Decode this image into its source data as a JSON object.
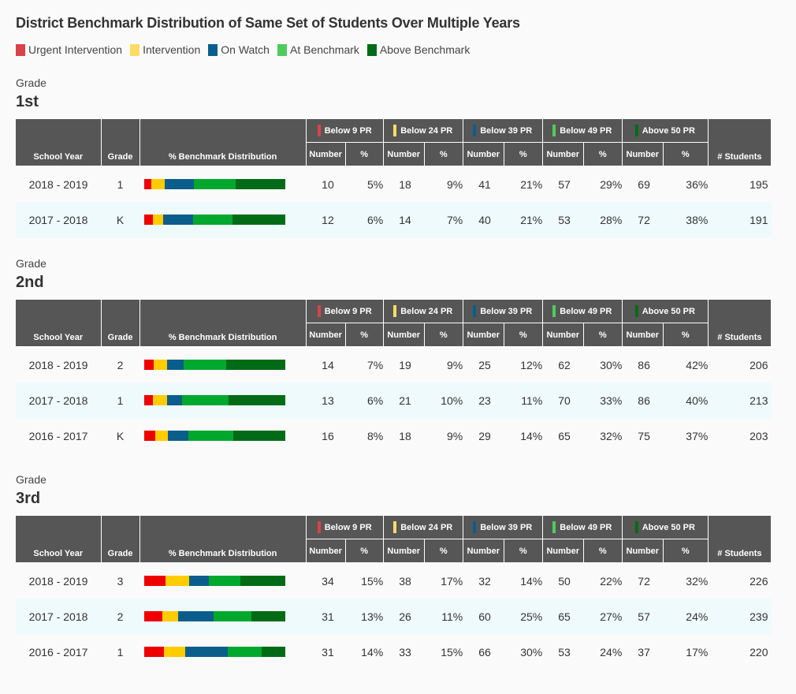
{
  "title": "District Benchmark Distribution of Same Set of Students Over Multiple Years",
  "colors": {
    "urgent": "#ee0000",
    "intervention": "#ffcc00",
    "watch": "#0b5e8c",
    "at": "#00a82d",
    "above": "#006b16",
    "legend_urgent": "#d9434a",
    "legend_intervention": "#ffdb66",
    "legend_watch": "#0b5e8c",
    "legend_at": "#4fcb5c",
    "legend_above": "#006b16",
    "header_bg": "#565656",
    "alt_row": "#effafc"
  },
  "legend": [
    {
      "label": "Urgent Intervention",
      "key": "legend_urgent"
    },
    {
      "label": "Intervention",
      "key": "legend_intervention"
    },
    {
      "label": "On Watch",
      "key": "legend_watch"
    },
    {
      "label": "At Benchmark",
      "key": "legend_at"
    },
    {
      "label": "Above Benchmark",
      "key": "legend_above"
    }
  ],
  "headers": {
    "school_year": "School Year",
    "grade": "Grade",
    "distribution": "% Benchmark Distribution",
    "number": "Number",
    "pct": "%",
    "students": "# Students",
    "groups": [
      {
        "label": "Below 9 PR",
        "key": "legend_urgent"
      },
      {
        "label": "Below 24 PR",
        "key": "legend_intervention"
      },
      {
        "label": "Below 39 PR",
        "key": "legend_watch"
      },
      {
        "label": "Below 49 PR",
        "key": "legend_at"
      },
      {
        "label": "Above 50 PR",
        "key": "legend_above"
      }
    ]
  },
  "grade_label": "Grade",
  "sections": [
    {
      "grade": "1st",
      "rows": [
        {
          "year": "2018 - 2019",
          "grade": "1",
          "values": [
            [
              10,
              "5%"
            ],
            [
              18,
              "9%"
            ],
            [
              41,
              "21%"
            ],
            [
              57,
              "29%"
            ],
            [
              69,
              "36%"
            ]
          ],
          "students": 195
        },
        {
          "year": "2017 - 2018",
          "grade": "K",
          "values": [
            [
              12,
              "6%"
            ],
            [
              14,
              "7%"
            ],
            [
              40,
              "21%"
            ],
            [
              53,
              "28%"
            ],
            [
              72,
              "38%"
            ]
          ],
          "students": 191
        }
      ]
    },
    {
      "grade": "2nd",
      "rows": [
        {
          "year": "2018 - 2019",
          "grade": "2",
          "values": [
            [
              14,
              "7%"
            ],
            [
              19,
              "9%"
            ],
            [
              25,
              "12%"
            ],
            [
              62,
              "30%"
            ],
            [
              86,
              "42%"
            ]
          ],
          "students": 206
        },
        {
          "year": "2017 - 2018",
          "grade": "1",
          "values": [
            [
              13,
              "6%"
            ],
            [
              21,
              "10%"
            ],
            [
              23,
              "11%"
            ],
            [
              70,
              "33%"
            ],
            [
              86,
              "40%"
            ]
          ],
          "students": 213
        },
        {
          "year": "2016 - 2017",
          "grade": "K",
          "values": [
            [
              16,
              "8%"
            ],
            [
              18,
              "9%"
            ],
            [
              29,
              "14%"
            ],
            [
              65,
              "32%"
            ],
            [
              75,
              "37%"
            ]
          ],
          "students": 203
        }
      ]
    },
    {
      "grade": "3rd",
      "rows": [
        {
          "year": "2018 - 2019",
          "grade": "3",
          "values": [
            [
              34,
              "15%"
            ],
            [
              38,
              "17%"
            ],
            [
              32,
              "14%"
            ],
            [
              50,
              "22%"
            ],
            [
              72,
              "32%"
            ]
          ],
          "students": 226
        },
        {
          "year": "2017 - 2018",
          "grade": "2",
          "values": [
            [
              31,
              "13%"
            ],
            [
              26,
              "11%"
            ],
            [
              60,
              "25%"
            ],
            [
              65,
              "27%"
            ],
            [
              57,
              "24%"
            ]
          ],
          "students": 239
        },
        {
          "year": "2016 - 2017",
          "grade": "1",
          "values": [
            [
              31,
              "14%"
            ],
            [
              33,
              "15%"
            ],
            [
              66,
              "30%"
            ],
            [
              53,
              "24%"
            ],
            [
              37,
              "17%"
            ]
          ],
          "students": 220
        }
      ]
    }
  ]
}
